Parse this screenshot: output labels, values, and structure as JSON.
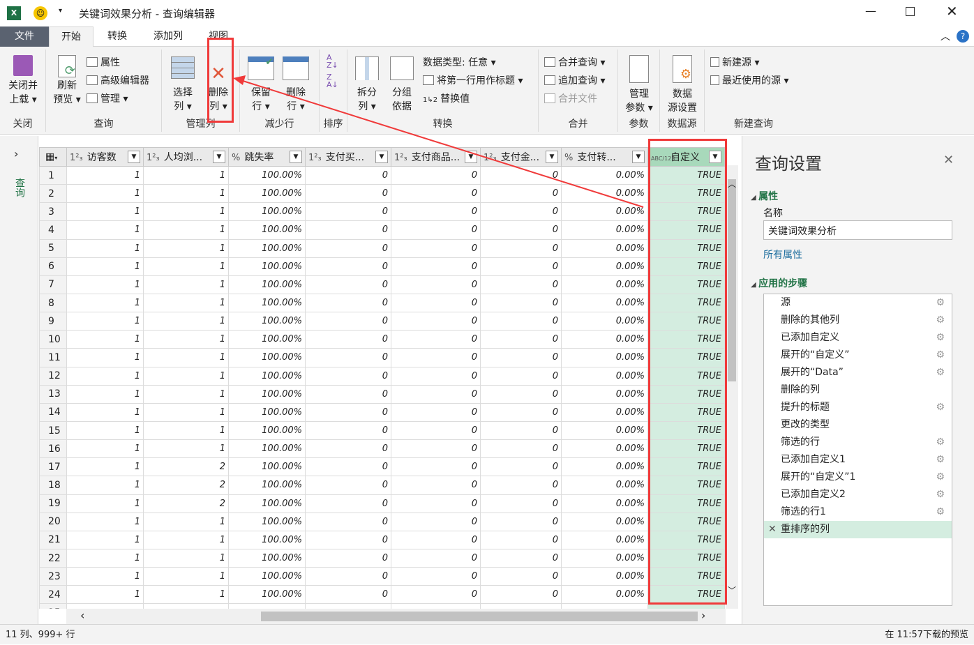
{
  "window": {
    "title": "关键词效果分析 - 查询编辑器"
  },
  "tabs": [
    "文件",
    "开始",
    "转换",
    "添加列",
    "视图"
  ],
  "ribbon": {
    "close": {
      "button": [
        "关闭并",
        "上载"
      ],
      "group": "关闭"
    },
    "query": {
      "refresh": [
        "刷新",
        "预览"
      ],
      "properties": "属性",
      "advanced_editor": "高级编辑器",
      "manage": "管理",
      "group": "查询"
    },
    "manage_columns": {
      "choose": [
        "选择",
        "列"
      ],
      "remove": [
        "删除",
        "列"
      ],
      "group": "管理列"
    },
    "reduce_rows": {
      "keep": [
        "保留",
        "行"
      ],
      "remove": [
        "删除",
        "行"
      ],
      "group": "减少行"
    },
    "sort": {
      "group": "排序"
    },
    "transform": {
      "split": [
        "拆分",
        "列"
      ],
      "group_by": [
        "分组",
        "依据"
      ],
      "data_type": "数据类型: 任意",
      "first_row_header": "将第一行用作标题",
      "replace": "替换值",
      "group": "转换"
    },
    "combine": {
      "merge": "合并查询",
      "append": "追加查询",
      "combine_files": "合并文件",
      "group": "合并"
    },
    "params": {
      "manage": [
        "管理",
        "参数"
      ],
      "group": "参数"
    },
    "datasource": {
      "settings": [
        "数据",
        "源设置"
      ],
      "group": "数据源"
    },
    "new_query": {
      "new_source": "新建源",
      "recent": "最近使用的源",
      "group": "新建查询"
    }
  },
  "left_pane": {
    "label": "查询"
  },
  "grid": {
    "columns": [
      {
        "type": "1²₃",
        "name": "访客数"
      },
      {
        "type": "1²₃",
        "name": "人均浏..."
      },
      {
        "type": "%",
        "name": "跳失率"
      },
      {
        "type": "1²₃",
        "name": "支付买..."
      },
      {
        "type": "1²₃",
        "name": "支付商品..."
      },
      {
        "type": "1²₃",
        "name": "支付金..."
      },
      {
        "type": "%",
        "name": "支付转..."
      },
      {
        "type": "ABC/123",
        "name": "自定义"
      }
    ],
    "rows": [
      [
        "1",
        "1",
        "100.00%",
        "0",
        "0",
        "0",
        "0.00%",
        "TRUE"
      ],
      [
        "1",
        "1",
        "100.00%",
        "0",
        "0",
        "0",
        "0.00%",
        "TRUE"
      ],
      [
        "1",
        "1",
        "100.00%",
        "0",
        "0",
        "0",
        "0.00%",
        "TRUE"
      ],
      [
        "1",
        "1",
        "100.00%",
        "0",
        "0",
        "0",
        "0.00%",
        "TRUE"
      ],
      [
        "1",
        "1",
        "100.00%",
        "0",
        "0",
        "0",
        "0.00%",
        "TRUE"
      ],
      [
        "1",
        "1",
        "100.00%",
        "0",
        "0",
        "0",
        "0.00%",
        "TRUE"
      ],
      [
        "1",
        "1",
        "100.00%",
        "0",
        "0",
        "0",
        "0.00%",
        "TRUE"
      ],
      [
        "1",
        "1",
        "100.00%",
        "0",
        "0",
        "0",
        "0.00%",
        "TRUE"
      ],
      [
        "1",
        "1",
        "100.00%",
        "0",
        "0",
        "0",
        "0.00%",
        "TRUE"
      ],
      [
        "1",
        "1",
        "100.00%",
        "0",
        "0",
        "0",
        "0.00%",
        "TRUE"
      ],
      [
        "1",
        "1",
        "100.00%",
        "0",
        "0",
        "0",
        "0.00%",
        "TRUE"
      ],
      [
        "1",
        "1",
        "100.00%",
        "0",
        "0",
        "0",
        "0.00%",
        "TRUE"
      ],
      [
        "1",
        "1",
        "100.00%",
        "0",
        "0",
        "0",
        "0.00%",
        "TRUE"
      ],
      [
        "1",
        "1",
        "100.00%",
        "0",
        "0",
        "0",
        "0.00%",
        "TRUE"
      ],
      [
        "1",
        "1",
        "100.00%",
        "0",
        "0",
        "0",
        "0.00%",
        "TRUE"
      ],
      [
        "1",
        "1",
        "100.00%",
        "0",
        "0",
        "0",
        "0.00%",
        "TRUE"
      ],
      [
        "1",
        "2",
        "100.00%",
        "0",
        "0",
        "0",
        "0.00%",
        "TRUE"
      ],
      [
        "1",
        "2",
        "100.00%",
        "0",
        "0",
        "0",
        "0.00%",
        "TRUE"
      ],
      [
        "1",
        "2",
        "100.00%",
        "0",
        "0",
        "0",
        "0.00%",
        "TRUE"
      ],
      [
        "1",
        "1",
        "100.00%",
        "0",
        "0",
        "0",
        "0.00%",
        "TRUE"
      ],
      [
        "1",
        "1",
        "100.00%",
        "0",
        "0",
        "0",
        "0.00%",
        "TRUE"
      ],
      [
        "1",
        "1",
        "100.00%",
        "0",
        "0",
        "0",
        "0.00%",
        "TRUE"
      ],
      [
        "1",
        "1",
        "100.00%",
        "0",
        "0",
        "0",
        "0.00%",
        "TRUE"
      ],
      [
        "1",
        "1",
        "100.00%",
        "0",
        "0",
        "0",
        "0.00%",
        "TRUE"
      ],
      [
        "",
        "",
        "",
        "",
        "",
        "",
        "",
        ""
      ]
    ]
  },
  "settings": {
    "title": "查询设置",
    "properties": "属性",
    "name_label": "名称",
    "name_value": "关键词效果分析",
    "all_properties": "所有属性",
    "steps_title": "应用的步骤",
    "steps": [
      {
        "name": "源",
        "gear": true
      },
      {
        "name": "删除的其他列",
        "gear": true
      },
      {
        "name": "已添加自定义",
        "gear": true
      },
      {
        "name": "展开的“自定义”",
        "gear": true
      },
      {
        "name": "展开的“Data”",
        "gear": true
      },
      {
        "name": "删除的列",
        "gear": false
      },
      {
        "name": "提升的标题",
        "gear": true
      },
      {
        "name": "更改的类型",
        "gear": false
      },
      {
        "name": "筛选的行",
        "gear": true
      },
      {
        "name": "已添加自定义1",
        "gear": true
      },
      {
        "name": "展开的“自定义”1",
        "gear": true
      },
      {
        "name": "已添加自定义2",
        "gear": true
      },
      {
        "name": "筛选的行1",
        "gear": true
      },
      {
        "name": "重排序的列",
        "gear": false,
        "selected": true
      }
    ]
  },
  "status": {
    "left": "11 列、999+ 行",
    "right": "在 11:57下载的预览"
  }
}
